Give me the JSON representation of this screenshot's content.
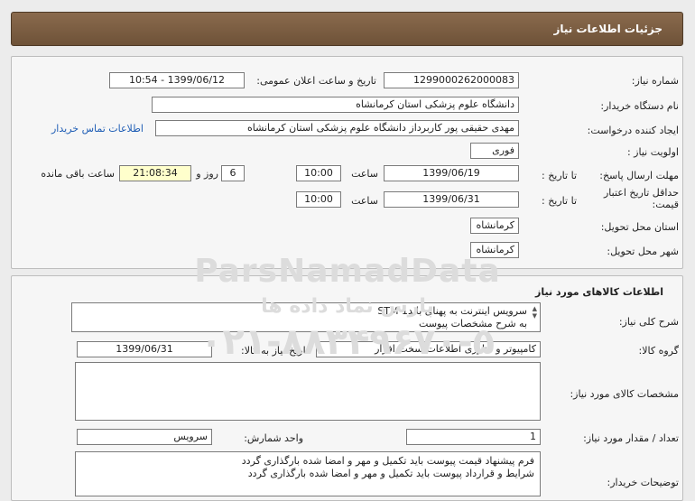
{
  "header": {
    "title": "جزئیات اطلاعات نیاز"
  },
  "need": {
    "number_label": "شماره نیاز:",
    "number": "1299000262000083",
    "announce_label": "تاریخ و ساعت اعلان عمومی:",
    "announce_value": "1399/06/12 - 10:54",
    "buyer_label": "نام دستگاه خریدار:",
    "buyer_value": "دانشگاه علوم پزشکی  استان کرمانشاه",
    "creator_label": "ایجاد کننده درخواست:",
    "creator_value": "مهدی حقیقی پور کاربرداز دانشگاه علوم پزشکی  استان کرمانشاه",
    "contact_link": "اطلاعات تماس خریدار",
    "priority_label": "اولویت نیاز :",
    "priority_value": "فوری",
    "deadline_label": "مهلت ارسال پاسخ:",
    "until_date_label": "تا تاریخ :",
    "deadline_date": "1399/06/19",
    "time_label": "ساعت",
    "deadline_time": "10:00",
    "days_value": "6",
    "days_label": "روز و",
    "remaining_time": "21:08:34",
    "remaining_label": "ساعت باقی مانده",
    "validity_label_1": "حداقل تاریخ اعتبار",
    "validity_label_2": "قیمت:",
    "validity_until_label": "تا تاریخ :",
    "validity_date": "1399/06/31",
    "validity_time_label": "ساعت",
    "validity_time": "10:00",
    "province_label": "استان محل تحویل:",
    "province_value": "کرمانشاه",
    "city_label": "شهر محل تحویل:",
    "city_value": "کرمانشاه"
  },
  "goods": {
    "title": "اطلاعات کالاهای مورد نیاز",
    "summary_label": "شرح کلی نیاز:",
    "summary_line1": "سرویس اینترنت به پهنای باندSTM 1",
    "summary_line2": "به شرح مشخصات پیوست",
    "group_label": "گروه کالا:",
    "group_value": "کامپیوتر و فناوری اطلاعات-سخت افزار",
    "need_date_label": "تاریخ نیاز به کالا:",
    "need_date": "1399/06/31",
    "specs_label": "مشخصات کالای مورد نیاز:",
    "qty_label": "تعداد / مقدار مورد نیاز:",
    "qty_value": "1",
    "unit_label": "واحد شمارش:",
    "unit_value": "سرویس",
    "buyer_notes_label": "توضیحات خریدار:",
    "note_line1": "فرم پیشنهاد قیمت پیوست باید تکمیل و مهر و امضا شده بارگذاری گردد",
    "note_line2": "شرایط و قرارداد پیوست باید تکمیل و مهر و امضا شده بارگذاری گردد"
  },
  "watermark": {
    "line1": "ParsNamadData",
    "line2": "پارس نماد داده ها",
    "line3": "۰۲۱-۸۸۳۴۹۶۷۰-۵"
  }
}
